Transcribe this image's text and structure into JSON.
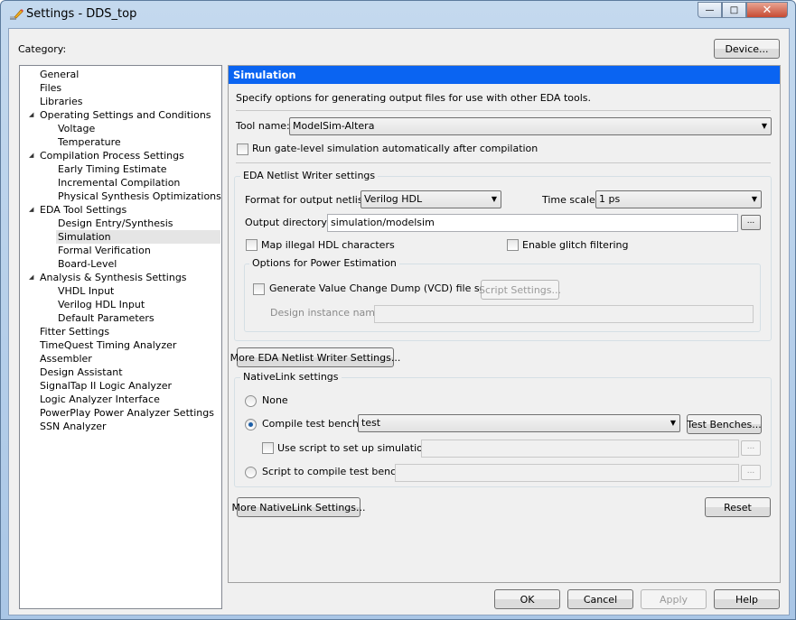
{
  "window": {
    "title": "Settings - DDS_top",
    "icon": "pencil-settings-icon",
    "minimize": "0",
    "maximize": "1",
    "close": "x"
  },
  "category_label": "Category:",
  "device_button": "Device...",
  "tree": [
    {
      "label": "General",
      "level": 0
    },
    {
      "label": "Files",
      "level": 0
    },
    {
      "label": "Libraries",
      "level": 0
    },
    {
      "label": "Operating Settings and Conditions",
      "level": 0,
      "expanded": true
    },
    {
      "label": "Voltage",
      "level": 1
    },
    {
      "label": "Temperature",
      "level": 1
    },
    {
      "label": "Compilation Process Settings",
      "level": 0,
      "expanded": true
    },
    {
      "label": "Early Timing Estimate",
      "level": 1
    },
    {
      "label": "Incremental Compilation",
      "level": 1
    },
    {
      "label": "Physical Synthesis Optimizations",
      "level": 1
    },
    {
      "label": "EDA Tool Settings",
      "level": 0,
      "expanded": true
    },
    {
      "label": "Design Entry/Synthesis",
      "level": 1
    },
    {
      "label": "Simulation",
      "level": 1,
      "selected": true
    },
    {
      "label": "Formal Verification",
      "level": 1
    },
    {
      "label": "Board-Level",
      "level": 1
    },
    {
      "label": "Analysis & Synthesis Settings",
      "level": 0,
      "expanded": true
    },
    {
      "label": "VHDL Input",
      "level": 1
    },
    {
      "label": "Verilog HDL Input",
      "level": 1
    },
    {
      "label": "Default Parameters",
      "level": 1
    },
    {
      "label": "Fitter Settings",
      "level": 0
    },
    {
      "label": "TimeQuest Timing Analyzer",
      "level": 0
    },
    {
      "label": "Assembler",
      "level": 0
    },
    {
      "label": "Design Assistant",
      "level": 0
    },
    {
      "label": "SignalTap II Logic Analyzer",
      "level": 0
    },
    {
      "label": "Logic Analyzer Interface",
      "level": 0
    },
    {
      "label": "PowerPlay Power Analyzer Settings",
      "level": 0
    },
    {
      "label": "SSN Analyzer",
      "level": 0
    }
  ],
  "panel": {
    "title": "Simulation",
    "header_color": "#0a64f2",
    "description": "Specify options for generating output files for use with other EDA tools.",
    "tool_name_label": "Tool name:",
    "tool_name_value": "ModelSim-Altera",
    "run_gate_level": {
      "label": "Run gate-level simulation automatically after compilation",
      "checked": false
    },
    "eda": {
      "legend": "EDA Netlist Writer settings",
      "format_label": "Format for output netlist:",
      "format_value": "Verilog HDL",
      "time_scale_label": "Time scale:",
      "time_scale_value": "1 ps",
      "output_dir_label": "Output directory:",
      "output_dir_value": "simulation/modelsim",
      "browse": "...",
      "map_illegal": {
        "label": "Map illegal HDL characters",
        "checked": false
      },
      "glitch": {
        "label": "Enable glitch filtering",
        "checked": false
      },
      "power": {
        "legend": "Options for Power Estimation",
        "vcd": {
          "label": "Generate Value Change Dump (VCD) file script",
          "checked": false
        },
        "script_settings": "Script Settings...",
        "instance_label": "Design instance name:",
        "instance_value": ""
      }
    },
    "more_eda": "More EDA Netlist Writer Settings...",
    "nativelink": {
      "legend": "NativeLink settings",
      "none": {
        "label": "None",
        "selected": false
      },
      "compile": {
        "label": "Compile test bench:",
        "selected": true,
        "value": "test"
      },
      "test_benches": "Test Benches...",
      "use_script": {
        "label": "Use script to set up simulation:",
        "checked": false,
        "value": ""
      },
      "script_compile": {
        "label": "Script to compile test bench:",
        "selected": false,
        "value": ""
      },
      "browse": "..."
    },
    "more_nativelink": "More NativeLink Settings...",
    "reset": "Reset"
  },
  "footer": {
    "ok": "OK",
    "cancel": "Cancel",
    "apply": "Apply",
    "help": "Help"
  }
}
